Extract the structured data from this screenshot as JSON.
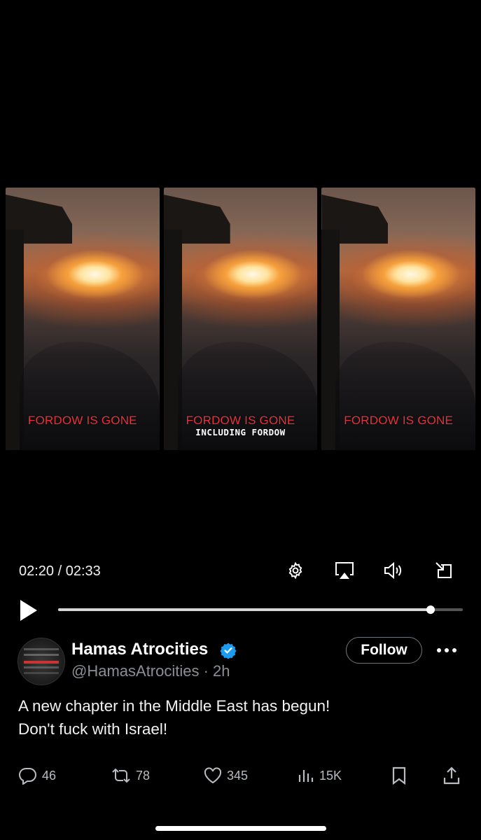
{
  "video": {
    "panels": [
      {
        "caption": "FORDOW IS GONE",
        "subcaption": ""
      },
      {
        "caption": "FORDOW IS GONE",
        "subcaption": "INCLUDING FORDOW"
      },
      {
        "caption": "FORDOW IS GONE",
        "subcaption": ""
      }
    ],
    "time": "02:20 / 02:33",
    "progress_fraction": 0.92,
    "icons": [
      "settings-icon",
      "airplay-icon",
      "volume-icon",
      "minimize-icon",
      "play-icon"
    ]
  },
  "tweet": {
    "display_name": "Hamas Atrocities",
    "handle_time": "@HamasAtrocities · 2h",
    "follow_label": "Follow",
    "text_line1": "A new chapter in the Middle East has begun!",
    "text_line2": "Don't fuck with Israel!",
    "avatar_text": "LOOK THEM IN THE EYES",
    "stats": {
      "replies": "46",
      "reposts": "78",
      "likes": "345",
      "views": "15K"
    }
  },
  "colors": {
    "background": "#000000",
    "caption_red": "#e5323c",
    "verified_blue": "#1d9bf0",
    "secondary_text": "#8b8f94"
  }
}
